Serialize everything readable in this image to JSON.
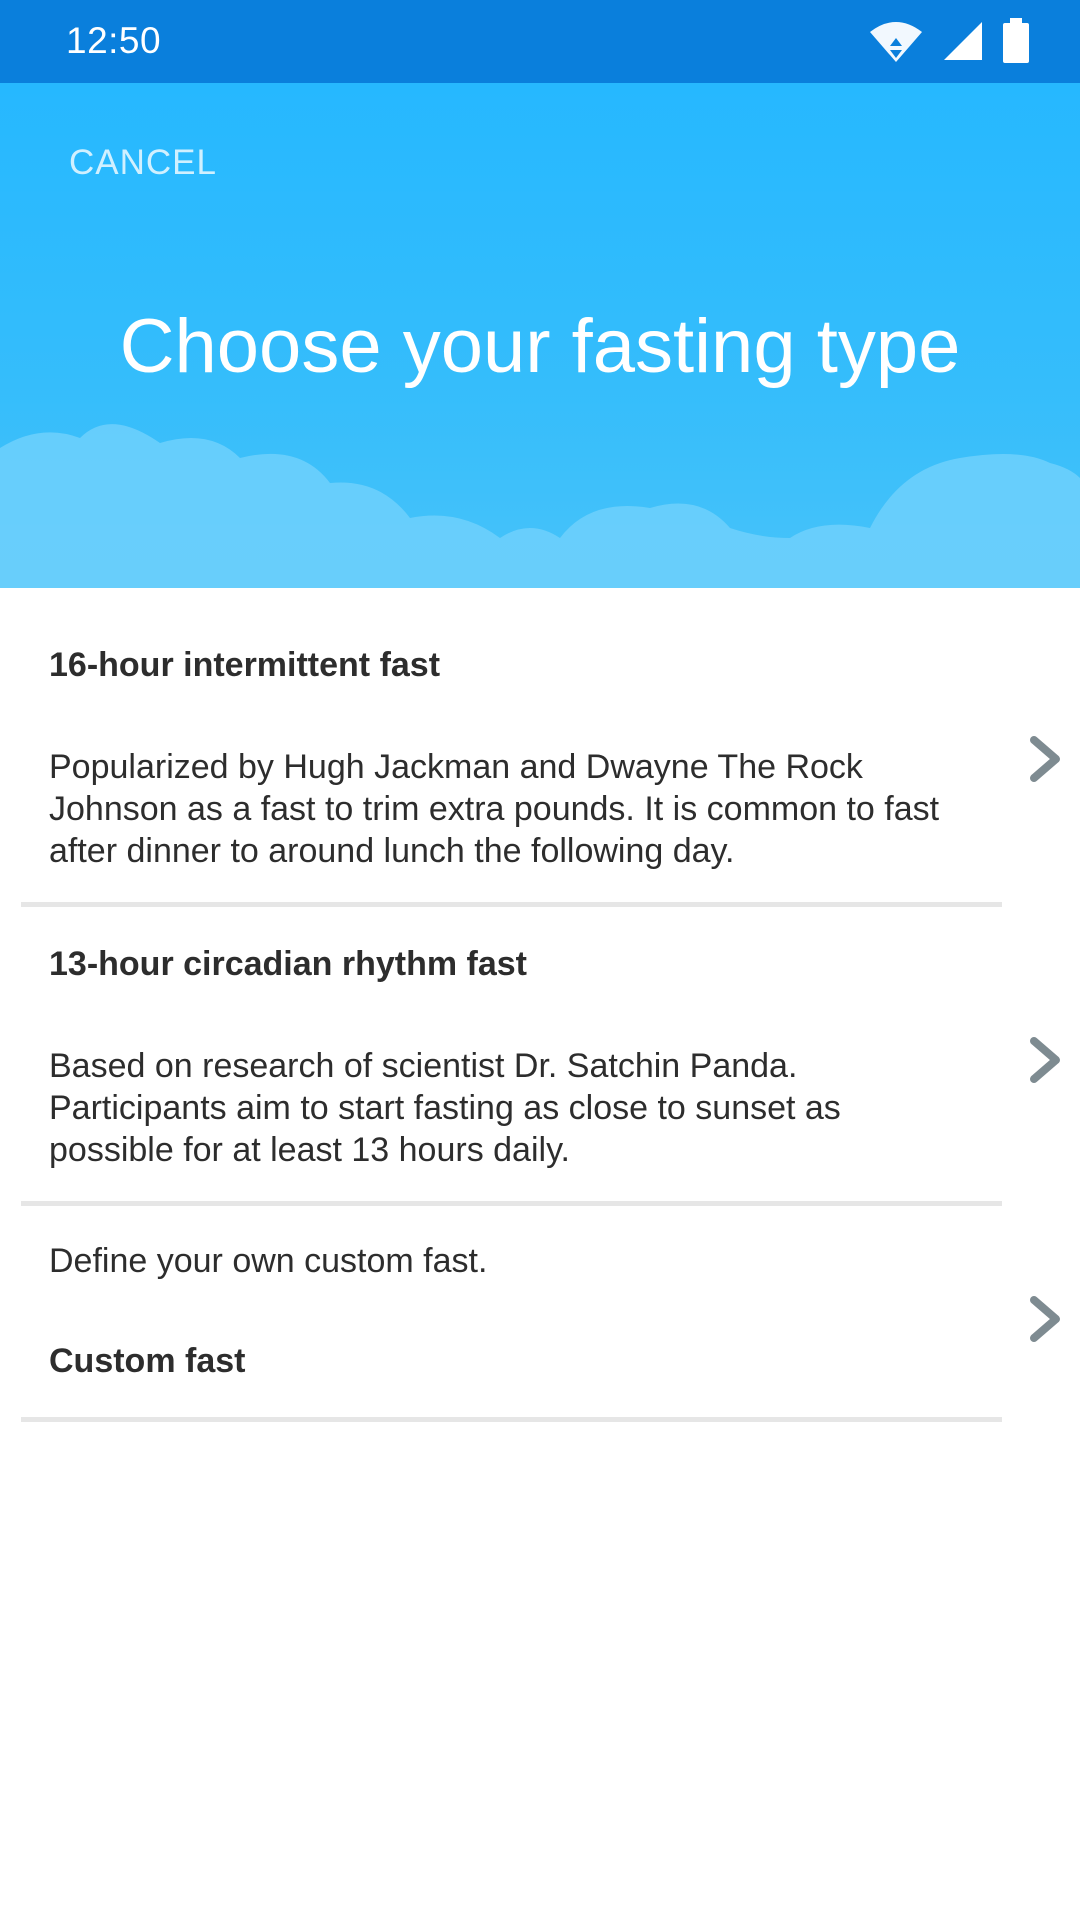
{
  "status_bar": {
    "time": "12:50",
    "icons": [
      "wifi-icon",
      "cell-signal-icon",
      "battery-icon"
    ],
    "background": "#0a7fdc"
  },
  "header": {
    "cancel_label": "CANCEL",
    "title": "Choose your fasting type",
    "background": "#26b8ff"
  },
  "options": [
    {
      "title": "16-hour intermittent fast",
      "description": "Popularized by Hugh Jackman and Dwayne The Rock Johnson as a fast to trim extra pounds. It is common to fast after dinner to around lunch the following day.",
      "icon": "chevron-right-icon"
    },
    {
      "title": "13-hour circadian rhythm fast",
      "description": "Based on research of scientist Dr. Satchin Panda. Participants aim to start fasting as close to sunset as possible for at least 13 hours daily.",
      "icon": "chevron-right-icon"
    },
    {
      "title": "Custom fast",
      "description": "Define your own custom fast.",
      "icon": "chevron-right-icon"
    }
  ]
}
